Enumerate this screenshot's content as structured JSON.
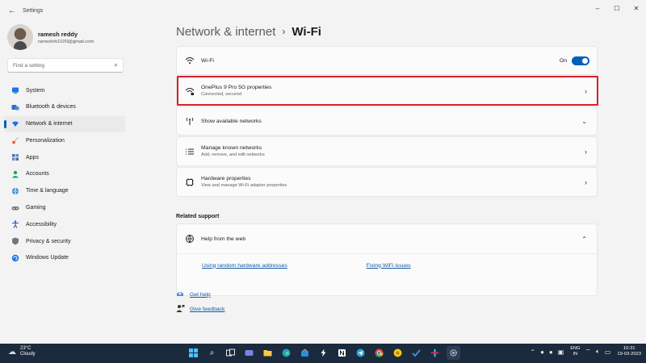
{
  "window": {
    "title": "Settings",
    "controls": [
      "–",
      "☐",
      "✕"
    ]
  },
  "profile": {
    "name": "ramesh reddy",
    "email": "rameshrk1020@gmail.com"
  },
  "search": {
    "placeholder": "Find a setting"
  },
  "sidebar": {
    "items": [
      {
        "label": "System",
        "icon": "system-icon",
        "active": false
      },
      {
        "label": "Bluetooth & devices",
        "icon": "bluetooth-icon",
        "active": false
      },
      {
        "label": "Network & internet",
        "icon": "network-icon",
        "active": true
      },
      {
        "label": "Personalization",
        "icon": "brush-icon",
        "active": false
      },
      {
        "label": "Apps",
        "icon": "apps-icon",
        "active": false
      },
      {
        "label": "Accounts",
        "icon": "accounts-icon",
        "active": false
      },
      {
        "label": "Time & language",
        "icon": "globe-icon",
        "active": false
      },
      {
        "label": "Gaming",
        "icon": "gamepad-icon",
        "active": false
      },
      {
        "label": "Accessibility",
        "icon": "accessibility-icon",
        "active": false
      },
      {
        "label": "Privacy & security",
        "icon": "shield-icon",
        "active": false
      },
      {
        "label": "Windows Update",
        "icon": "update-icon",
        "active": false
      }
    ]
  },
  "breadcrumb": {
    "parent": "Network & internet",
    "separator": "›",
    "current": "Wi-Fi"
  },
  "wifi_card": {
    "label": "Wi-Fi",
    "toggle_label": "On",
    "toggle_on": true
  },
  "network_card": {
    "title": "OnePlus 9 Pro 5G properties",
    "subtitle": "Connected, secured"
  },
  "available_card": {
    "title": "Show available networks"
  },
  "known_card": {
    "title": "Manage known networks",
    "subtitle": "Add, remove, and edit networks"
  },
  "hardware_card": {
    "title": "Hardware properties",
    "subtitle": "View and manage Wi-Fi adapter properties"
  },
  "related_support": {
    "title": "Related support",
    "help_web": "Help from the web",
    "links": [
      "Using random hardware addresses",
      "Fixing WiFi issues"
    ]
  },
  "help": {
    "get_help": "Get help",
    "give_feedback": "Give feedback"
  },
  "taskbar": {
    "weather_temp": "23°C",
    "weather_desc": "Cloudy",
    "lang_line1": "ENG",
    "lang_line2": "IN",
    "time": "10:31",
    "date": "19-03-2023"
  },
  "colors": {
    "accent": "#005fb8",
    "highlight_border": "#d8202a",
    "taskbar_bg": "#1b2a3d"
  }
}
